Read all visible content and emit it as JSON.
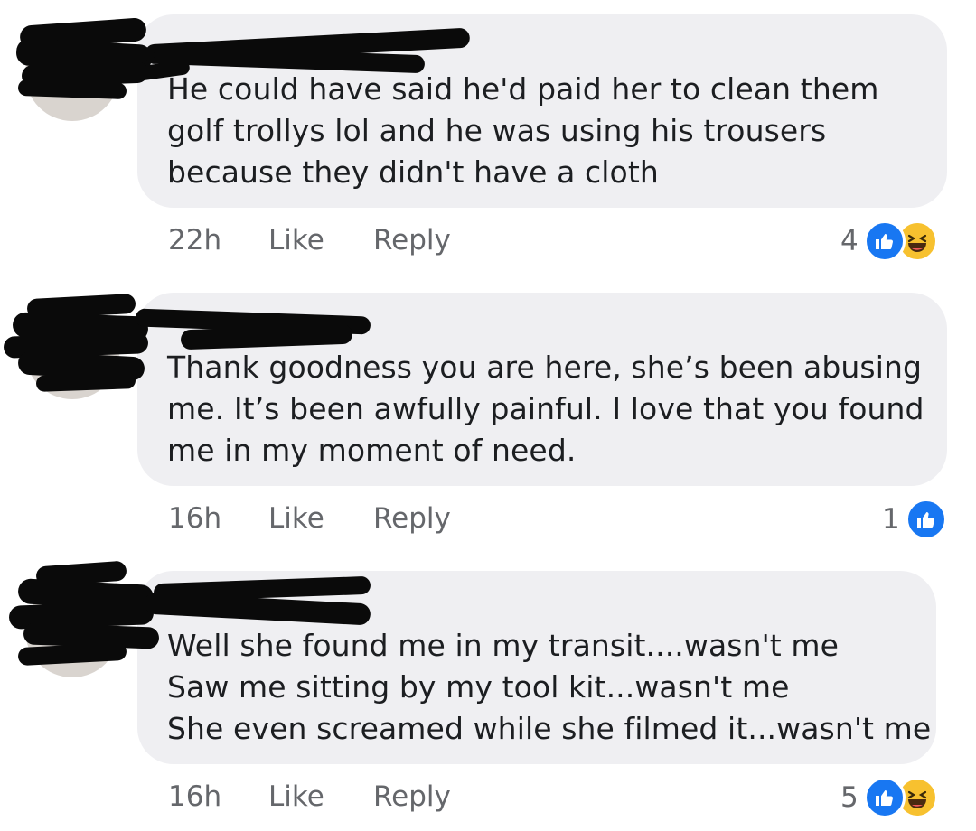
{
  "comments": [
    {
      "text_lines": [
        "He could have said he'd paid her to clean them",
        "golf trollys lol and he was using his trousers",
        "because they didn't have a cloth"
      ],
      "time": "22h",
      "like_label": "Like",
      "reply_label": "Reply",
      "reaction_count": "4",
      "reactions": [
        "like-icon",
        "haha-icon"
      ]
    },
    {
      "text_lines": [
        "Thank goodness you are here, she’s been abusing",
        "me. It’s been awfully painful. I love that you found",
        "me in my moment of need."
      ],
      "time": "16h",
      "like_label": "Like",
      "reply_label": "Reply",
      "reaction_count": "1",
      "reactions": [
        "like-icon"
      ]
    },
    {
      "text_lines": [
        "Well she found me in my transit....wasn't me",
        "Saw me sitting by my tool kit...wasn't me",
        "She even screamed while she filmed it...wasn't me"
      ],
      "time": "16h",
      "like_label": "Like",
      "reply_label": "Reply",
      "reaction_count": "5",
      "reactions": [
        "like-icon",
        "haha-icon"
      ]
    }
  ],
  "colors": {
    "bubble": "#efeff2",
    "text": "#1c1e21",
    "meta": "#65676b",
    "like_blue": "#1877f2",
    "haha_yellow": "#f7c12f",
    "redaction": "#0a0a0a"
  }
}
